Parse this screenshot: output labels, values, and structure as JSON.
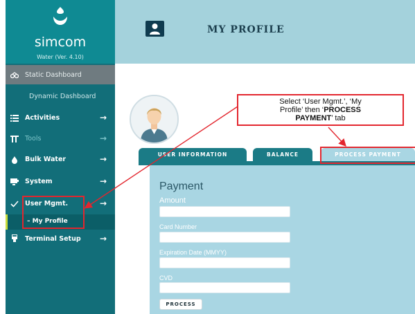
{
  "brand": {
    "name": "simcom",
    "version": "Water (Ver. 4.10)"
  },
  "sidebar": {
    "items": [
      {
        "label": "Static Dashboard",
        "icon": "dashboard-icon"
      },
      {
        "label": "Dynamic Dashboard",
        "icon": ""
      },
      {
        "label": "Activities",
        "icon": "list-icon",
        "arrow": "→"
      },
      {
        "label": "Tools",
        "icon": "tools-icon",
        "arrow": "→"
      },
      {
        "label": "Bulk Water",
        "icon": "water-drop-icon",
        "arrow": "→"
      },
      {
        "label": "System",
        "icon": "monitor-icon",
        "arrow": "→"
      },
      {
        "label": "User Mgmt.",
        "icon": "check-icon",
        "arrow": "→"
      },
      {
        "label": "Terminal Setup",
        "icon": "terminal-icon",
        "arrow": "→"
      }
    ],
    "sub_item": {
      "label": "– My Profile"
    }
  },
  "header": {
    "title": "MY PROFILE"
  },
  "callout": {
    "line1": "Select ‘User Mgmt.’, ‘My",
    "line2a": "Profile’ then ‘",
    "line2b": "PROCESS",
    "line3a": "PAYMENT",
    "line3b": "’ tab"
  },
  "tabs": [
    "USER INFORMATION",
    "BALANCE",
    "PROCESS PAYMENT"
  ],
  "payment": {
    "heading": "Payment",
    "amount_label": "Amount",
    "card_label": "Card Number",
    "expiry_label": "Expiration Date (MMYY)",
    "cvd_label": "CVD",
    "process_button": "PROCESS"
  },
  "colors": {
    "sidebar": "#126e79",
    "header": "#a4d2dc",
    "panel": "#a9d6e3",
    "highlight": "#e3262e"
  }
}
